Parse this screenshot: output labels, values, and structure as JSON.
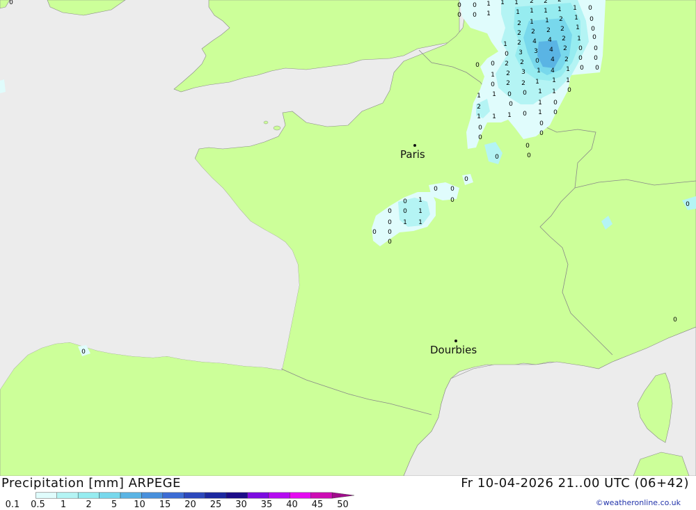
{
  "map": {
    "colors": {
      "sea": "#ececec",
      "land": "#ccff99",
      "border": "#888888"
    },
    "cities": [
      {
        "name": "Paris"
      },
      {
        "name": "Dourbies"
      }
    ]
  },
  "footer": {
    "title": "Precipitation [mm] ARPEGE",
    "valid_time": "Fr 10-04-2026 21..00 UTC (06+42)",
    "credit": "©weatheronline.co.uk"
  },
  "scale": {
    "labels": [
      "0.1",
      "0.5",
      "1",
      "2",
      "5",
      "10",
      "15",
      "20",
      "25",
      "30",
      "35",
      "40",
      "45",
      "50"
    ],
    "colors": [
      "#e0fcfc",
      "#b4f4f4",
      "#96ecf0",
      "#78d8ec",
      "#5ab4e4",
      "#4890dc",
      "#3c6cd4",
      "#2c48bc",
      "#1c28a0",
      "#1c0c88",
      "#7c0ce0",
      "#b40cf0",
      "#e40cf0",
      "#cc0cb4",
      "#a00c8c"
    ]
  }
}
